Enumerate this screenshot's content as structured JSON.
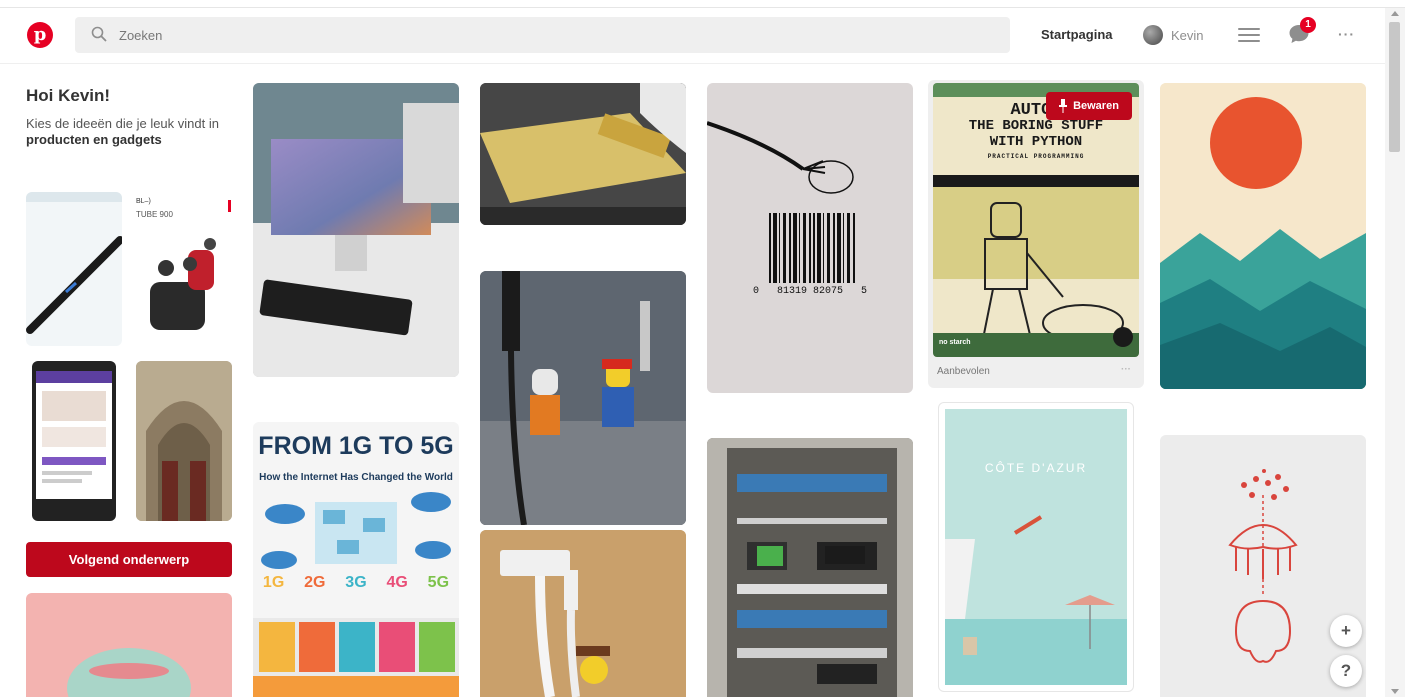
{
  "header": {
    "logo": "p",
    "search_placeholder": "Zoeken",
    "nav_home": "Startpagina",
    "user_name": "Kevin",
    "notification_count": "1",
    "more": "···"
  },
  "sidebar": {
    "greeting": "Hoi Kevin!",
    "prompt": "Kies de ideeën die je leuk vindt in",
    "topic": "producten en gadgets",
    "thumb_tube_label": "TUBE 900",
    "thumb_tube_brand": "BL–)",
    "next_button": "Volgend onderwerp"
  },
  "pins": {
    "infographic_from": "FROM 1G TO 5G",
    "infographic_subtitle": "How the Internet Has Changed the World",
    "generations": [
      "1G",
      "2G",
      "3G",
      "4G",
      "5G"
    ],
    "barcode_number": "0   81319 82075   5",
    "book_title_1": "AUTOM",
    "book_title_2": "THE BORING STUFF",
    "book_title_3": "WITH PYTHON",
    "book_subtitle": "PRACTICAL PROGRAMMING",
    "book_publisher": "no starch",
    "save_button": "Bewaren",
    "book_caption": "Aanbevolen",
    "book_more": "···",
    "poster_title": "CÔTE D'AZUR"
  },
  "fabs": {
    "add": "+",
    "help": "?"
  },
  "colors": {
    "brand_red": "#e60023",
    "button_red": "#bd081c"
  }
}
